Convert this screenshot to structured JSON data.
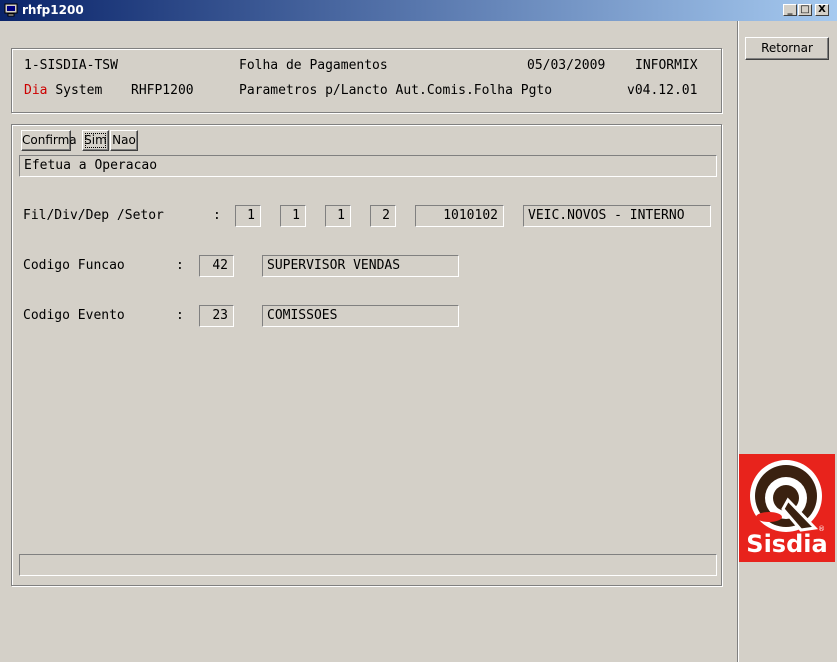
{
  "window": {
    "title": "rhfp1200",
    "minimize": "_",
    "maximize": "□",
    "close": "X"
  },
  "header": {
    "company": "1-SISDIA-TSW",
    "module": "Folha de Pagamentos",
    "date": "05/03/2009",
    "db": "INFORMIX",
    "brand_red": "Dia",
    "brand_rest": "System",
    "program": "RHFP1200",
    "description": "Parametros p/Lancto Aut.Comis.Folha Pgto",
    "version": "v04.12.01"
  },
  "actions": {
    "confirm": "Confirma",
    "yes": "Sim",
    "no": "Nao"
  },
  "message": "Efetua a Operacao",
  "form": {
    "fil_label": "Fil/Div/Dep /Setor",
    "fil_colon": ":",
    "fil": "1",
    "div": "1",
    "dep": "1",
    "setor": "2",
    "setor_code": "1010102",
    "setor_desc": "VEIC.NOVOS - INTERNO",
    "funcao_label": "Codigo Funcao",
    "funcao_colon": ":",
    "funcao_code": "42",
    "funcao_desc": "SUPERVISOR VENDAS",
    "evento_label": "Codigo Evento",
    "evento_colon": ":",
    "evento_code": "23",
    "evento_desc": "COMISSOES"
  },
  "status_bar": "",
  "sidebar": {
    "return_button": "Retornar"
  },
  "logo": {
    "text": "Sisdia",
    "reg": "®"
  },
  "colors": {
    "accent_red": "#cc0000",
    "titlebar": "#0a246a"
  }
}
